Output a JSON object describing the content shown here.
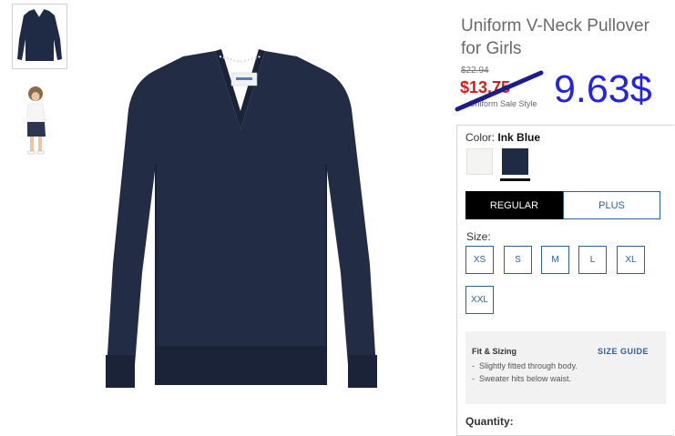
{
  "product": {
    "title": "Uniform V-Neck Pullover for Girls",
    "original_price": "$22.94",
    "sale_price": "$13.75",
    "sale_note": "Uniform Sale Style",
    "handwritten_price": "9.63$"
  },
  "color": {
    "label": "Color:",
    "selected_name": "Ink Blue",
    "swatches": [
      {
        "name": "white",
        "hex": "#f4f4f2"
      },
      {
        "name": "Ink Blue",
        "hex": "#1f2a44"
      }
    ]
  },
  "fit_tabs": [
    {
      "label": "REGULAR",
      "selected": true
    },
    {
      "label": "PLUS",
      "selected": false
    }
  ],
  "size": {
    "label": "Size:",
    "options": [
      "XS",
      "S",
      "M",
      "L",
      "XL",
      "XXL"
    ]
  },
  "fit_sizing": {
    "title": "Fit & Sizing",
    "guide_link": "SIZE GUIDE",
    "notes": [
      "Slightly fitted through body.",
      "Sweater hits below waist."
    ]
  },
  "quantity_label": "Quantity:",
  "colors": {
    "accent": "#2f5f9c",
    "sale_red": "#d31d1d",
    "product_navy": "#1f2a44",
    "annotation_blue": "#2323e0"
  }
}
